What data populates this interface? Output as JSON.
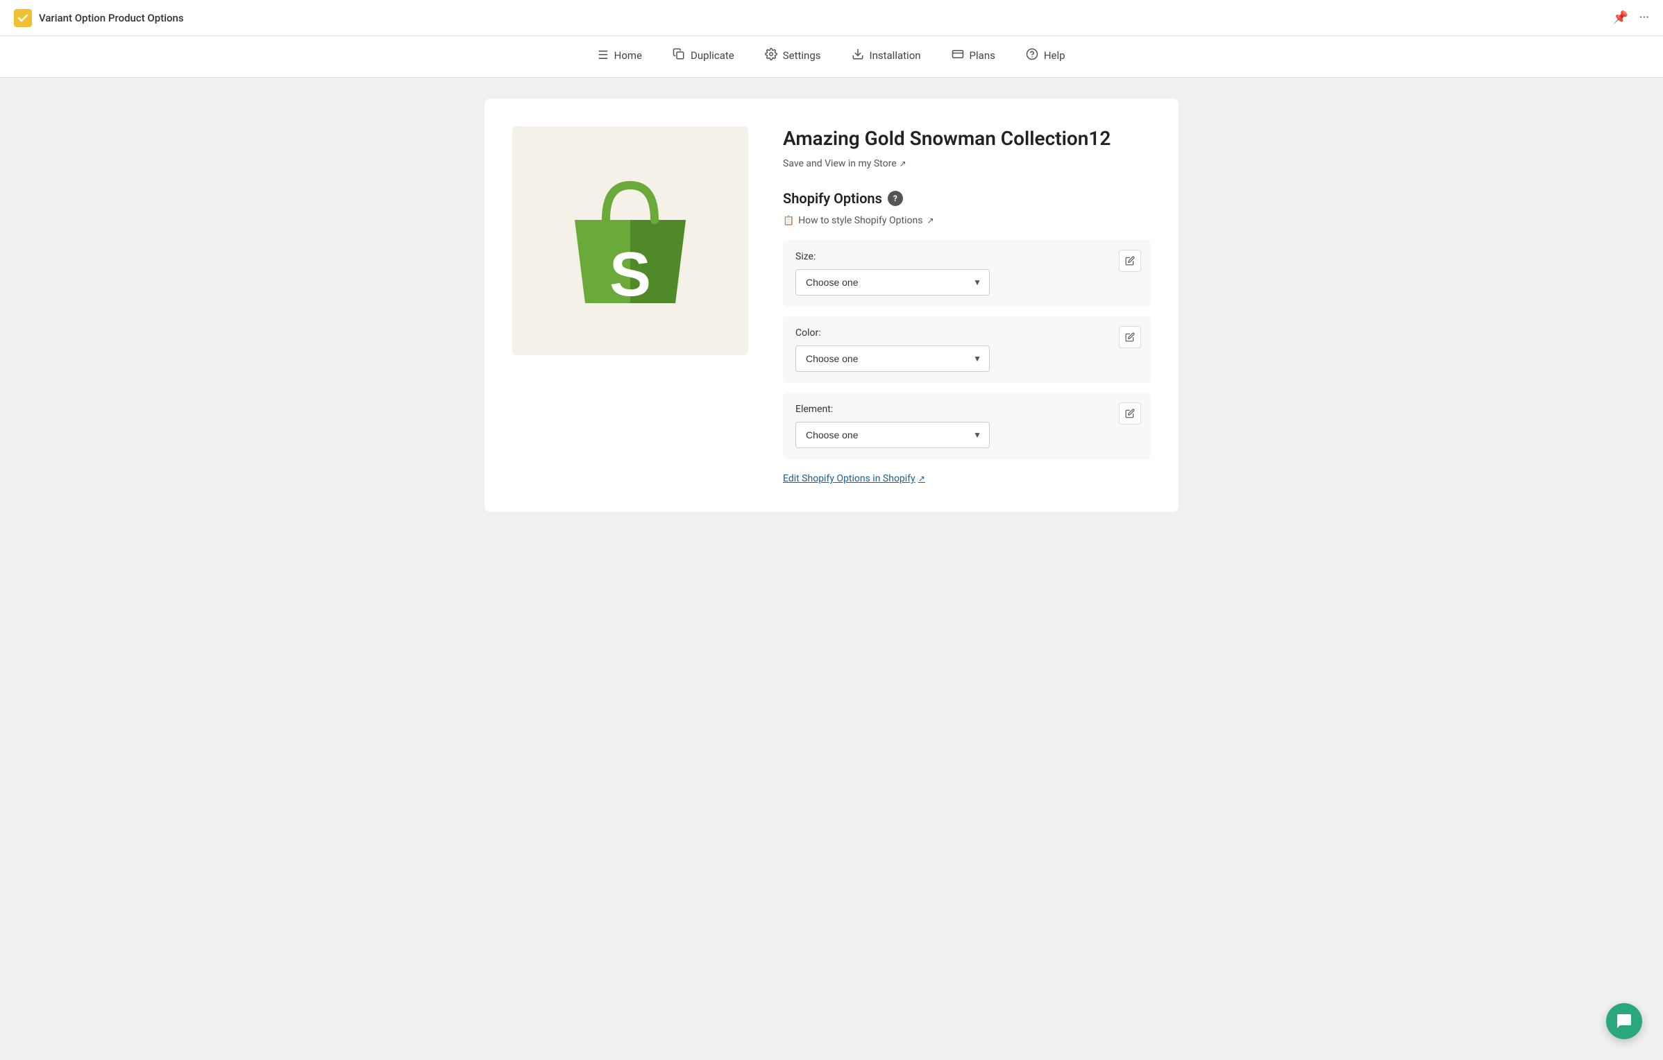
{
  "app": {
    "title": "Variant Option Product Options",
    "logo_bg": "#f0c030"
  },
  "nav": {
    "items": [
      {
        "id": "home",
        "label": "Home",
        "icon": "☰"
      },
      {
        "id": "duplicate",
        "label": "Duplicate",
        "icon": "⧉"
      },
      {
        "id": "settings",
        "label": "Settings",
        "icon": "🔧"
      },
      {
        "id": "installation",
        "label": "Installation",
        "icon": "⬇"
      },
      {
        "id": "plans",
        "label": "Plans",
        "icon": "💳"
      },
      {
        "id": "help",
        "label": "Help",
        "icon": "❓"
      }
    ]
  },
  "product": {
    "title": "Amazing Gold Snowman Collection12",
    "save_view_label": "Save and View in my Store",
    "shopify_options_title": "Shopify Options",
    "style_link": "How to style Shopify Options",
    "edit_shopify_link": "Edit Shopify Options in Shopify",
    "options": [
      {
        "id": "size",
        "label": "Size:",
        "placeholder": "Choose one"
      },
      {
        "id": "color",
        "label": "Color:",
        "placeholder": "Choose one"
      },
      {
        "id": "element",
        "label": "Element:",
        "placeholder": "Choose one"
      }
    ]
  },
  "topbar": {
    "pin_label": "📌",
    "dots_label": "···"
  }
}
